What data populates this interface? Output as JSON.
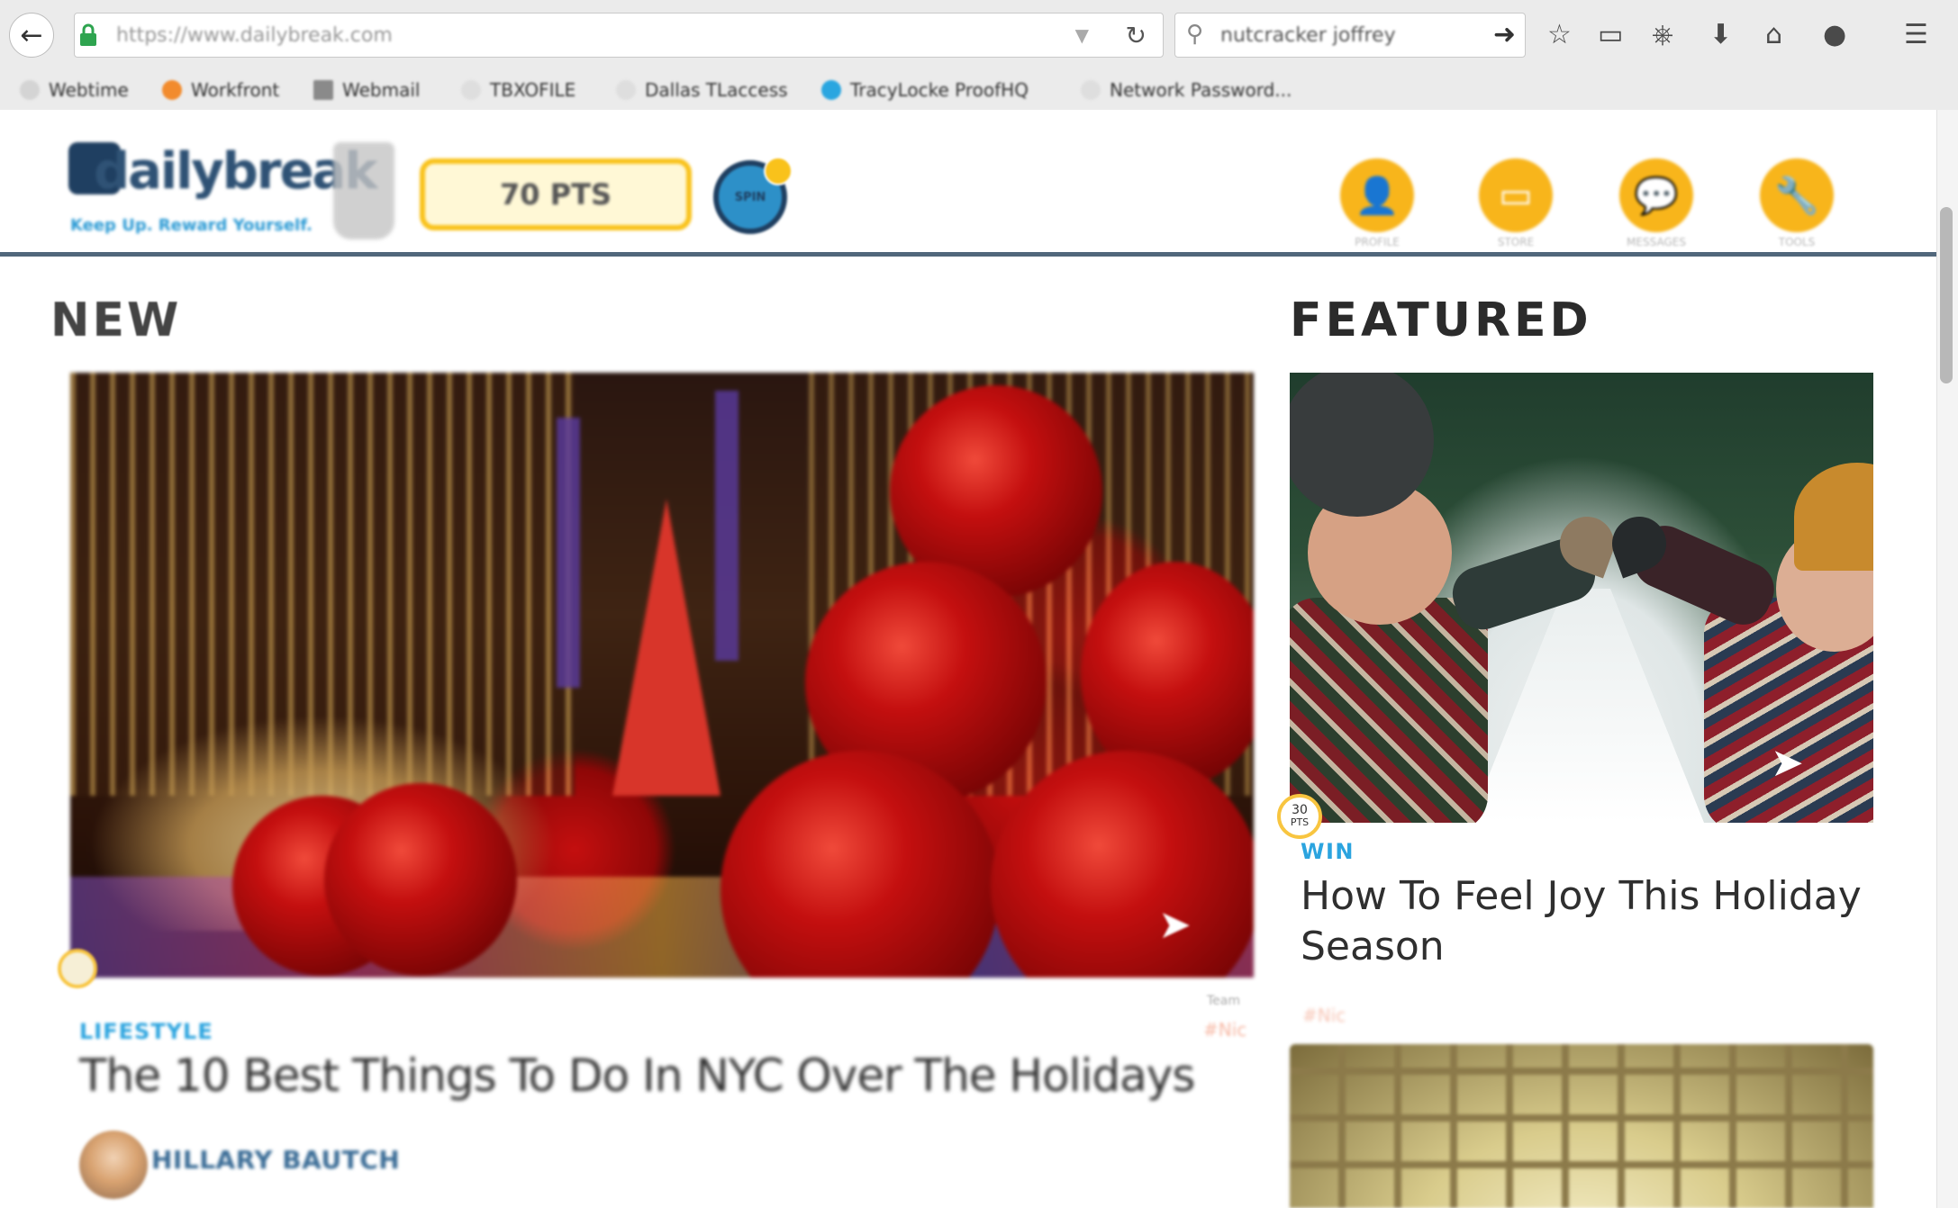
{
  "browser": {
    "url": "https://www.dailybreak.com",
    "search_text": "nutcracker joffrey",
    "bookmarks": [
      {
        "label": "Webtime",
        "color": "#7c7c7c"
      },
      {
        "label": "Workfront",
        "color": "#f28b2d"
      },
      {
        "label": "Webmail",
        "color": "#7c7c7c"
      },
      {
        "label": "TBXOFILE",
        "color": "#d4d4d4"
      },
      {
        "label": "Dallas TLaccess",
        "color": "#d4d4d4"
      },
      {
        "label": "TracyLocke ProofHQ",
        "color": "#2aa6e0"
      },
      {
        "label": "Network Password...",
        "color": "#d4d4d4"
      }
    ]
  },
  "header": {
    "logo_text": "dailybreak",
    "tagline": "Keep Up. Reward Yourself.",
    "points": "70 PTS",
    "spin_label": "SPIN",
    "nav": [
      {
        "label": "PROFILE",
        "icon": "profile-icon",
        "glyph": "👤"
      },
      {
        "label": "STORE",
        "icon": "store-icon",
        "glyph": "▭"
      },
      {
        "label": "MESSAGES",
        "icon": "messages-icon",
        "glyph": "💬"
      },
      {
        "label": "TOOLS",
        "icon": "tools-icon",
        "glyph": "🔧"
      }
    ],
    "accent_color": "#f8b51b",
    "rule_color": "#51677b"
  },
  "new_section": {
    "title": "NEW",
    "hero": {
      "category": "LIFESTYLE",
      "title": "The 10 Best Things To Do In NYC Over The Holidays",
      "meta_small": "Team",
      "meta_tag": "#Nic",
      "author": "HILLARY BAUTCH"
    }
  },
  "featured_section": {
    "title": "FEATURED",
    "card": {
      "points_value": "30",
      "points_unit": "PTS",
      "category": "WIN",
      "title": "How To Feel Joy This Holiday Season",
      "meta_tag": "#Nic"
    }
  }
}
